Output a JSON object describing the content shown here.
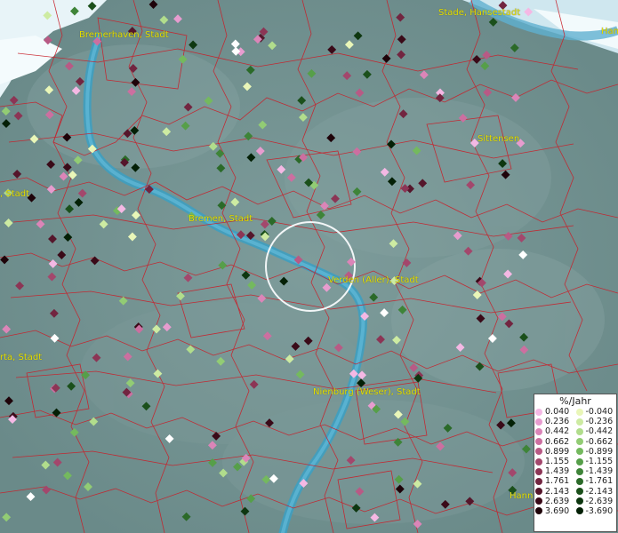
{
  "map": {
    "city_labels": [
      "Bremerhaven, Stadt",
      "Stade, Hansestadt",
      "Ham",
      "Sittensen",
      ", Stadt",
      "Bremen, Stadt",
      "Verden (Aller), Stadt",
      "rta, Stadt",
      "Nienburg (Weser), Stadt",
      "Hann"
    ]
  },
  "legend": {
    "title": "%/Jahr",
    "positive": [
      {
        "label": "0.040",
        "color": "#f4b8e4"
      },
      {
        "label": "0.236",
        "color": "#e79ccf"
      },
      {
        "label": "0.442",
        "color": "#db85b8"
      },
      {
        "label": "0.662",
        "color": "#cc6fa0"
      },
      {
        "label": "0.899",
        "color": "#b85a85"
      },
      {
        "label": "1.155",
        "color": "#a3476c"
      },
      {
        "label": "1.439",
        "color": "#8c3555"
      },
      {
        "label": "1.761",
        "color": "#722540"
      },
      {
        "label": "2.143",
        "color": "#55162b"
      },
      {
        "label": "2.639",
        "color": "#3a0a18"
      },
      {
        "label": "3.690",
        "color": "#1e0309"
      }
    ],
    "negative": [
      {
        "label": "-0.040",
        "color": "#e9f6b8"
      },
      {
        "label": "-0.236",
        "color": "#cdeba2"
      },
      {
        "label": "-0.442",
        "color": "#b1dd8c"
      },
      {
        "label": "-0.662",
        "color": "#92cc74"
      },
      {
        "label": "-0.899",
        "color": "#74b95e"
      },
      {
        "label": "-1.155",
        "color": "#569f49"
      },
      {
        "label": "-1.439",
        "color": "#3e8438"
      },
      {
        "label": "-1.761",
        "color": "#2b6a29"
      },
      {
        "label": "-2.143",
        "color": "#1b501b"
      },
      {
        "label": "-2.639",
        "color": "#0e3710"
      },
      {
        "label": "-3.690",
        "color": "#042006"
      }
    ]
  }
}
